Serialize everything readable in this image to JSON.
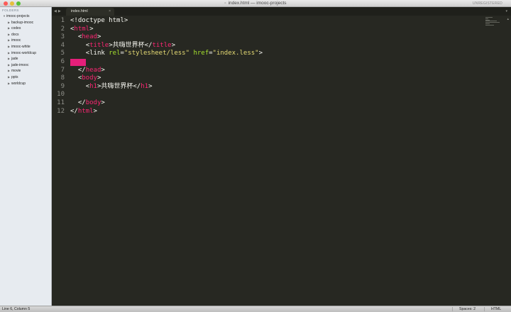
{
  "window": {
    "title": "index.html — imooc-projects",
    "unregistered": "UNREGISTERED"
  },
  "sidebar": {
    "header": "FOLDERS",
    "root": "imooc-projects",
    "items": [
      {
        "label": "backup-imooc"
      },
      {
        "label": "codes"
      },
      {
        "label": "docs"
      },
      {
        "label": "imooc"
      },
      {
        "label": "imooc-white"
      },
      {
        "label": "imooc-worldcup"
      },
      {
        "label": "jade"
      },
      {
        "label": "jade-imooc"
      },
      {
        "label": "movie"
      },
      {
        "label": "ppts"
      },
      {
        "label": "worldcup"
      }
    ]
  },
  "tabs": [
    {
      "label": "index.html",
      "close": "×"
    }
  ],
  "editor": {
    "line_numbers": [
      "1",
      "2",
      "3",
      "4",
      "5",
      "6",
      "7",
      "8",
      "9",
      "10",
      "11",
      "12"
    ],
    "tokens": {
      "l1": "<!doctype html>",
      "l2_open": "<",
      "l2_tag": "html",
      "l2_close": ">",
      "l3_open": "<",
      "l3_tag": "head",
      "l3_close": ">",
      "l4_open": "<",
      "l4_tag": "title",
      "l4_mid": ">共嗨世界杯</",
      "l4_tag2": "title",
      "l4_close": ">",
      "l5_open": "<link ",
      "l5_attr1": "rel",
      "l5_eq1": "=",
      "l5_val1": "\"stylesheet/less\"",
      "l5_sp": " ",
      "l5_attr2": "href",
      "l5_eq2": "=",
      "l5_val2": "\"index.less\"",
      "l5_close": ">",
      "l7_open": "</",
      "l7_tag": "head",
      "l7_close": ">",
      "l8_open": "<",
      "l8_tag": "body",
      "l8_close": ">",
      "l9_open": "<",
      "l9_tag": "h1",
      "l9_mid": ">共嗨世界杯</",
      "l9_tag2": "h1",
      "l9_close": ">",
      "l11_open": "</",
      "l11_tag": "body",
      "l11_close": ">",
      "l12_open": "</",
      "l12_tag": "html",
      "l12_close": ">"
    },
    "colors": {
      "background": "#272822",
      "tag": "#f92672",
      "attribute": "#a6e22e",
      "string": "#e6db74",
      "text": "#f8f8f2",
      "line_highlight": "#e51f7a"
    }
  },
  "statusbar": {
    "position": "Line 6, Column 5",
    "spaces": "Spaces: 2",
    "syntax": "HTML"
  }
}
